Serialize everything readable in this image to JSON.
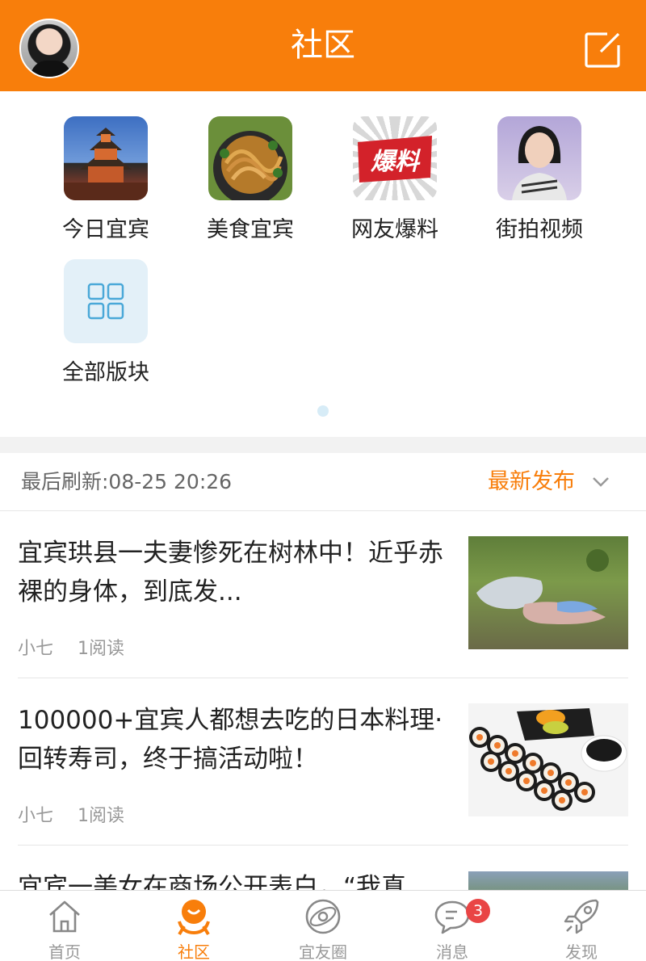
{
  "header": {
    "title": "社区"
  },
  "categories": [
    {
      "label": "今日宜宾",
      "icon": "tower-photo"
    },
    {
      "label": "美食宜宾",
      "icon": "noodles-photo"
    },
    {
      "label": "网友爆料",
      "icon": "baoliao-logo",
      "logo_text": "爆料"
    },
    {
      "label": "街拍视频",
      "icon": "girl-photo"
    },
    {
      "label": "全部版块",
      "icon": "grid-icon"
    }
  ],
  "list_header": {
    "refresh": "最后刷新:08-25 20:26",
    "sort": "最新发布"
  },
  "articles": [
    {
      "title": "宜宾珙县一夫妻惨死在树林中！近乎赤裸的身体，到底发...",
      "author": "小七",
      "reads": "1阅读"
    },
    {
      "title": "100000+宜宾人都想去吃的日本料理·回转寿司，终于搞活动啦！",
      "author": "小七",
      "reads": "1阅读"
    },
    {
      "title": "宜宾一美女在商场公开表白，“我真",
      "author": "",
      "reads": ""
    }
  ],
  "tabbar": {
    "items": [
      {
        "label": "首页",
        "icon": "home-icon"
      },
      {
        "label": "社区",
        "icon": "community-icon"
      },
      {
        "label": "宜友圈",
        "icon": "orbit-icon"
      },
      {
        "label": "消息",
        "icon": "message-icon"
      },
      {
        "label": "发现",
        "icon": "rocket-icon"
      }
    ],
    "message_badge": "3"
  },
  "colors": {
    "accent": "#f87e0b",
    "badge": "#e94545"
  }
}
